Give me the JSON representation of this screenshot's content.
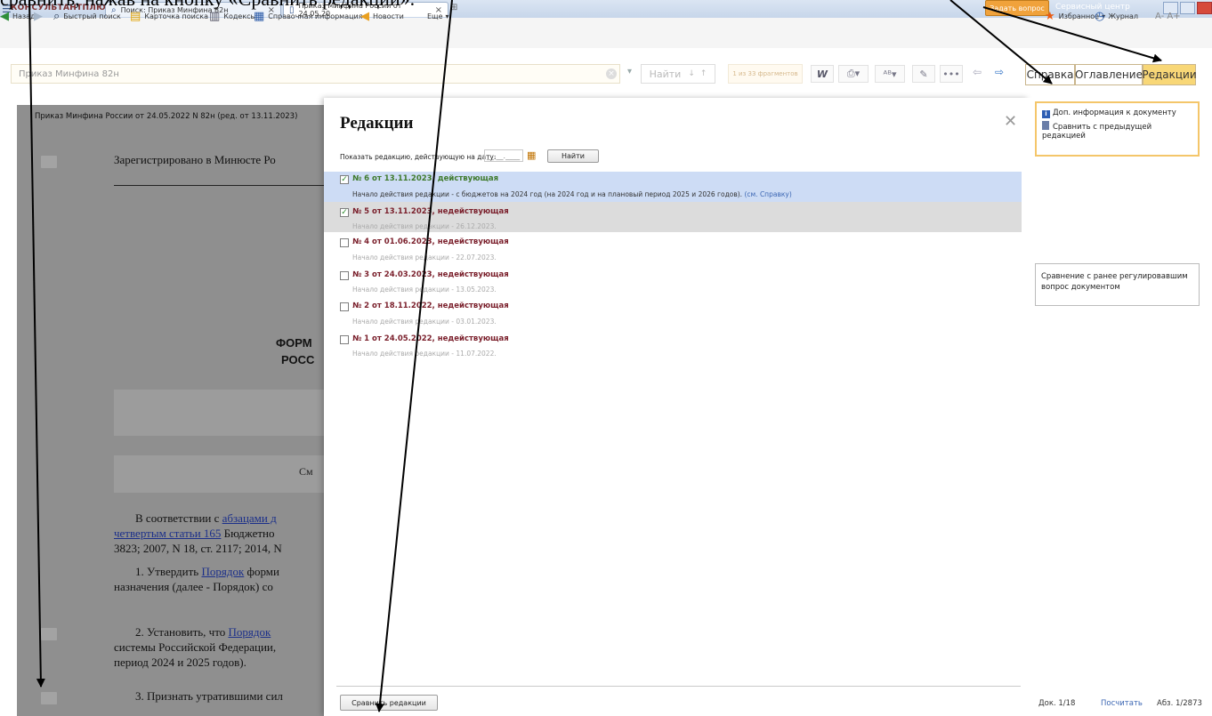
{
  "caption": "сравнить, нажав на кнопку «Сравнить редакции».",
  "tabbar": {
    "brand": "КОНСУЛЬТАНТПЛЮС",
    "tab1": "Поиск: Приказ Минфина 82н",
    "tab2": "Приказ Минфина России от 24.05.20",
    "ask_button": "Задать вопрос",
    "service": "Сервисный центр"
  },
  "toolbar": {
    "back": "Назад",
    "quick_search": "Быстрый поиск",
    "search_card": "Карточка поиска",
    "codes": "Кодексы",
    "reference": "Справочная информация",
    "news": "Новости",
    "more": "Еще",
    "favorites": "Избранное",
    "journal": "Журнал",
    "font_size": "A- A+"
  },
  "search": {
    "value": "Приказ Минфина 82н",
    "find_label": "Найти",
    "fragments": "1 из 33 фрагментов"
  },
  "right_tabs": {
    "help": "Справка",
    "toc": "Оглавление",
    "redactions": "Редакции"
  },
  "document": {
    "header": "Приказ Минфина России от 24.05.2022 N 82н (ред. от 13.11.2023)",
    "registered": "Зарегистрировано в Минюсте Ро",
    "heading1": "ФОРМ",
    "heading2": "РОСС",
    "box2_text": "См",
    "p1_line1_pre": "В соответствии с ",
    "p1_line1_link": "абзацами д",
    "p1_line2_link": "четвертым статьи 165",
    "p1_line2_post": " Бюджетно",
    "p1_line3": "3823; 2007, N 18, ст. 2117; 2014, N",
    "p2_line1_pre": "1. Утвердить ",
    "p2_line1_link": "Порядок",
    "p2_line1_post": " форми",
    "p2_line2": "назначения (далее - Порядок) со",
    "p3_line1_pre": "2. Установить, что ",
    "p3_line1_link": "Порядок",
    "p3_line2": "системы Российской Федерации,",
    "p3_line3": "период 2024 и 2025 годов).",
    "p4_line1": "3. Признать утратившими сил"
  },
  "modal": {
    "title": "Редакции",
    "date_label": "Показать редакцию, действующую на дату:",
    "date_value": "__.__.____",
    "find_button": "Найти",
    "revisions": [
      {
        "title": "№ 6 от 13.11.2023, действующая",
        "sub": "Начало действия редакции - с бюджетов на 2024 год (на 2024 год и на плановый период 2025 и 2026 годов).",
        "link": "(см. Справку)",
        "checked": true,
        "active": true
      },
      {
        "title": "№ 5 от 13.11.2023, недействующая",
        "sub": "Начало действия редакции - 26.12.2023.",
        "checked": true
      },
      {
        "title": "№ 4 от 01.06.2023, недействующая",
        "sub": "Начало действия редакции - 22.07.2023.",
        "checked": false
      },
      {
        "title": "№ 3 от 24.03.2023, недействующая",
        "sub": "Начало действия редакции - 13.05.2023.",
        "checked": false
      },
      {
        "title": "№ 2 от 18.11.2022, недействующая",
        "sub": "Начало действия редакции - 03.01.2023.",
        "checked": false
      },
      {
        "title": "№ 1 от 24.05.2022, недействующая",
        "sub": "Начало действия редакции - 11.07.2022.",
        "checked": false
      }
    ],
    "compare_button": "Сравнить редакции"
  },
  "right_panel": {
    "info1": "Доп. информация к документу",
    "info2": "Сравнить с предыдущей редакцией",
    "compare_reg": "Сравнение с ранее регулировавшим вопрос документом",
    "status_doc": "Док. 1/18",
    "status_count": "Посчитать",
    "status_abz": "Абз. 1/2873"
  },
  "colors": {
    "active_revision": "#3f7a2c",
    "inactive_revision": "#7a1f2b",
    "highlight_tab": "#f8d777",
    "arrow": "#000000"
  }
}
